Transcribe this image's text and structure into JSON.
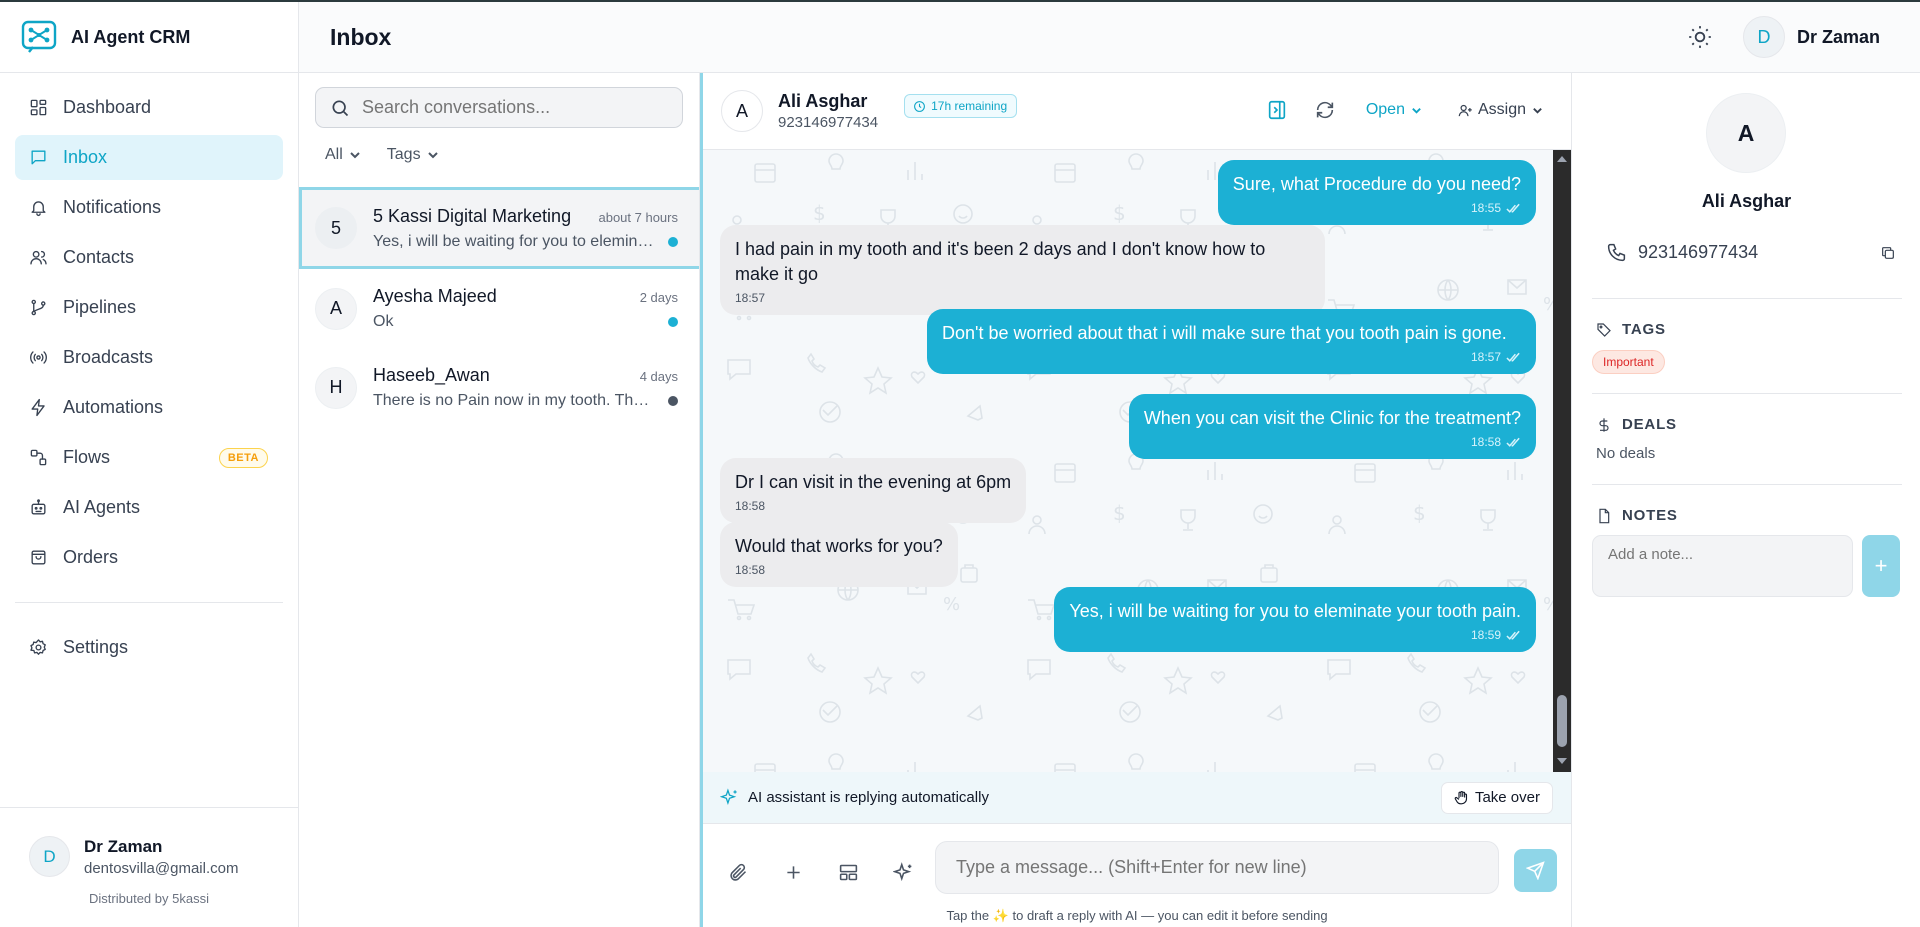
{
  "app": {
    "name": "AI Agent CRM",
    "brand_color": "#0ea5c6"
  },
  "sidebar": {
    "items": [
      {
        "label": "Dashboard",
        "icon": "dashboard-icon"
      },
      {
        "label": "Inbox",
        "icon": "chat-icon",
        "active": true
      },
      {
        "label": "Notifications",
        "icon": "bell-icon"
      },
      {
        "label": "Contacts",
        "icon": "users-icon"
      },
      {
        "label": "Pipelines",
        "icon": "branch-icon"
      },
      {
        "label": "Broadcasts",
        "icon": "broadcast-icon"
      },
      {
        "label": "Automations",
        "icon": "bolt-icon"
      },
      {
        "label": "Flows",
        "icon": "flow-icon",
        "badge": "BETA"
      },
      {
        "label": "AI Agents",
        "icon": "bot-icon"
      },
      {
        "label": "Orders",
        "icon": "bag-icon"
      }
    ],
    "settings_label": "Settings",
    "user": {
      "initial": "D",
      "name": "Dr Zaman",
      "email": "dentosvilla@gmail.com"
    },
    "distributed": "Distributed by 5kassi"
  },
  "topbar": {
    "title": "Inbox",
    "user_initial": "D",
    "user_name": "Dr Zaman"
  },
  "conversations": {
    "search_placeholder": "Search conversations...",
    "filters": [
      "All",
      "Tags"
    ],
    "items": [
      {
        "initial": "5",
        "name": "5 Kassi Digital Marketing",
        "time": "about 7 hours",
        "preview": "Yes, i will be waiting for you to eleminate your tooth pain.",
        "dot": "#1cb0d4",
        "active": true
      },
      {
        "initial": "A",
        "name": "Ayesha Majeed",
        "time": "2 days",
        "preview": "Ok",
        "dot": "#1cb0d4"
      },
      {
        "initial": "H",
        "name": "Haseeb_Awan",
        "time": "4 days",
        "preview": "There is no Pain now in my tooth. Thank you",
        "dot": "#4b5563"
      }
    ]
  },
  "chat": {
    "contact_initial": "A",
    "contact_name": "Ali Asghar",
    "contact_phone": "923146977434",
    "remaining": "17h remaining",
    "status": "Open",
    "assign": "Assign",
    "messages": [
      {
        "dir": "out",
        "text": "Sure, what Procedure do you need?",
        "time": "18:55"
      },
      {
        "dir": "in",
        "text": "I had pain in my tooth and it's been 2 days and I don't know how to make it go",
        "time": "18:57"
      },
      {
        "dir": "out",
        "text": "Don't be worried about that i will make sure that you tooth pain is gone.",
        "time": "18:57"
      },
      {
        "dir": "out",
        "text": "When you can visit the Clinic for the treatment?",
        "time": "18:58"
      },
      {
        "dir": "in",
        "text": "Dr I can visit in the evening at 6pm",
        "time": "18:58"
      },
      {
        "dir": "in",
        "text": "Would that works for you?",
        "time": "18:58"
      },
      {
        "dir": "out",
        "text": "Yes, i will be waiting for you to eleminate your tooth pain.",
        "time": "18:59"
      }
    ],
    "ai_status": "AI assistant is replying automatically",
    "takeover_label": "Take over",
    "input_placeholder": "Type a message... (Shift+Enter for new line)",
    "hint": "Tap the ✨ to draft a reply with AI — you can edit it before sending"
  },
  "details": {
    "initial": "A",
    "name": "Ali Asghar",
    "phone": "923146977434",
    "tags_title": "TAGS",
    "tags": [
      "Important"
    ],
    "deals_title": "DEALS",
    "deals_empty": "No deals",
    "notes_title": "NOTES",
    "note_placeholder": "Add a note...",
    "note_add": "+"
  }
}
